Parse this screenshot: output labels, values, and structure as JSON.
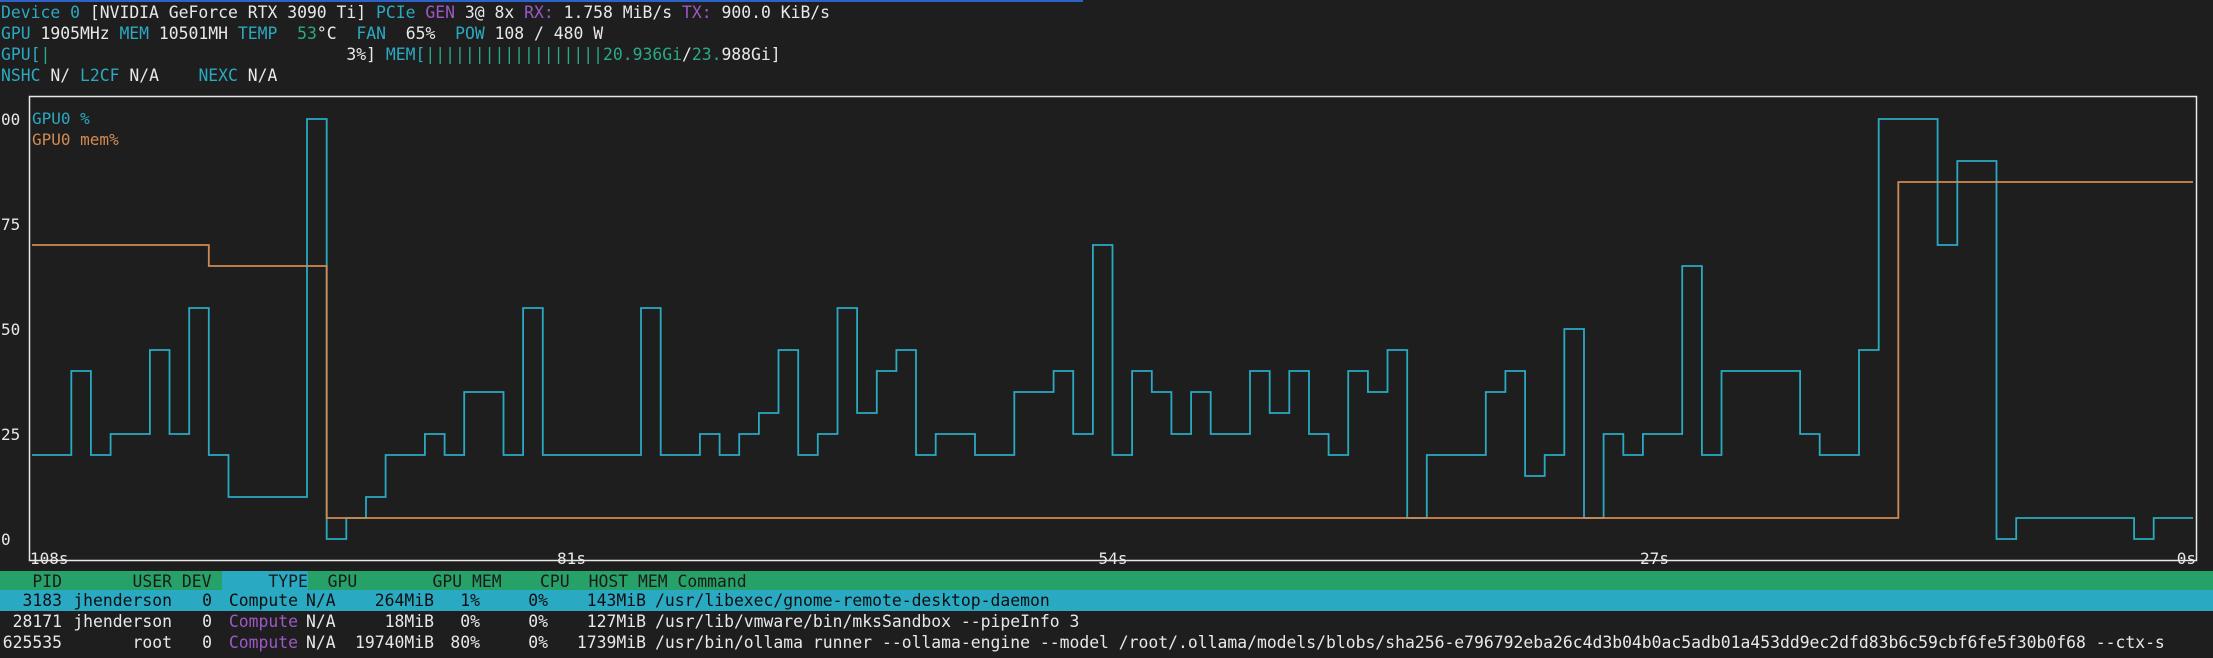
{
  "device": {
    "label": "Device",
    "index": "0",
    "name": "[NVIDIA GeForce RTX 3090 Ti]",
    "pcie_label": "PCIe",
    "gen_label": "GEN",
    "gen_value": "3@ 8x",
    "rx_label": "RX:",
    "rx_value": "1.758 MiB/s",
    "tx_label": "TX:",
    "tx_value": "900.0 KiB/s"
  },
  "stats": {
    "gpu_label": "GPU",
    "gpu_clock": "1905MHz",
    "mem_label": "MEM",
    "mem_clock": "10501MH",
    "temp_label": "TEMP",
    "temp_value": "53",
    "temp_unit": "°C",
    "fan_label": "FAN",
    "fan_value": "65%",
    "pow_label": "POW",
    "pow_value": "108 / 480 W"
  },
  "bars": {
    "gpu_bar_label": "GPU[",
    "gpu_bar_fill": "|",
    "gpu_bar_value": "3%]",
    "mem_bar_label": "MEM[",
    "mem_bar_fill": "||||||||||||||||||",
    "mem_used": "20.936Gi",
    "mem_sep": "/",
    "mem_total_a": "23.",
    "mem_total_b": "988Gi]"
  },
  "nvlink": {
    "nshc_label": "NSHC",
    "nshc_value": "N/",
    "l2cf_label": "L2CF",
    "l2cf_value": "N/A",
    "nexc_label": "NEXC",
    "nexc_value": "N/A"
  },
  "chart_data": {
    "type": "line",
    "ylim": [
      0,
      100
    ],
    "yticks": [
      "00",
      "75",
      "50",
      "25",
      "0"
    ],
    "xticks": [
      "108s",
      "81s",
      "54s",
      "27s",
      "0s"
    ],
    "series": [
      {
        "name": "GPU0 %",
        "color": "#2aa9c2",
        "values": [
          20,
          20,
          40,
          20,
          25,
          25,
          45,
          25,
          55,
          20,
          10,
          10,
          10,
          10,
          100,
          0,
          5,
          10,
          20,
          20,
          25,
          20,
          35,
          35,
          20,
          55,
          20,
          20,
          20,
          20,
          20,
          55,
          20,
          20,
          25,
          20,
          25,
          30,
          45,
          20,
          25,
          55,
          30,
          40,
          45,
          20,
          25,
          25,
          20,
          20,
          35,
          35,
          40,
          25,
          70,
          20,
          40,
          35,
          25,
          35,
          25,
          25,
          40,
          30,
          40,
          25,
          20,
          40,
          35,
          45,
          5,
          20,
          20,
          20,
          35,
          40,
          15,
          20,
          50,
          5,
          25,
          20,
          25,
          25,
          65,
          20,
          40,
          40,
          40,
          40,
          25,
          20,
          20,
          45,
          100,
          100,
          100,
          70,
          90,
          90,
          0,
          5,
          5,
          5,
          5,
          5,
          5,
          0,
          5,
          5
        ]
      },
      {
        "name": "GPU0 mem%",
        "color": "#d18a52",
        "values": [
          70,
          70,
          70,
          70,
          70,
          70,
          70,
          70,
          70,
          65,
          65,
          65,
          65,
          65,
          65,
          5,
          5,
          5,
          5,
          5,
          5,
          5,
          5,
          5,
          5,
          5,
          5,
          5,
          5,
          5,
          5,
          5,
          5,
          5,
          5,
          5,
          5,
          5,
          5,
          5,
          5,
          5,
          5,
          5,
          5,
          5,
          5,
          5,
          5,
          5,
          5,
          5,
          5,
          5,
          5,
          5,
          5,
          5,
          5,
          5,
          5,
          5,
          5,
          5,
          5,
          5,
          5,
          5,
          5,
          5,
          5,
          5,
          5,
          5,
          5,
          5,
          5,
          5,
          5,
          5,
          5,
          5,
          5,
          5,
          5,
          5,
          5,
          5,
          5,
          5,
          5,
          5,
          5,
          5,
          5,
          85,
          85,
          85,
          85,
          85,
          85,
          85,
          85,
          85,
          85,
          85,
          85,
          85,
          85,
          85
        ]
      }
    ]
  },
  "process_table": {
    "columns": [
      "PID",
      "USER",
      "DEV",
      "TYPE",
      "GPU",
      "GPU MEM",
      "CPU",
      "HOST MEM",
      "Command"
    ],
    "rows": [
      {
        "pid": "3183",
        "user": "jhenderson",
        "dev": "0",
        "type": "Compute",
        "gpu": "N/A",
        "gpu_mem": "264MiB",
        "gpu_mem_pct": "1%",
        "cpu": "0%",
        "host_mem": "143MiB",
        "command": "/usr/libexec/gnome-remote-desktop-daemon"
      },
      {
        "pid": "28171",
        "user": "jhenderson",
        "dev": "0",
        "type": "Compute",
        "gpu": "N/A",
        "gpu_mem": "18MiB",
        "gpu_mem_pct": "0%",
        "cpu": "0%",
        "host_mem": "127MiB",
        "command": "/usr/lib/vmware/bin/mksSandbox --pipeInfo 3"
      },
      {
        "pid": "625535",
        "user": "root",
        "dev": "0",
        "type": "Compute",
        "gpu": "N/A",
        "gpu_mem": "19740MiB",
        "gpu_mem_pct": "80%",
        "cpu": "0%",
        "host_mem": "1739MiB",
        "command": "/usr/bin/ollama runner --ollama-engine --model /root/.ollama/models/blobs/sha256-e796792eba26c4d3b04b0ac5adb01a453dd9ec2dfd83b6c59cbf6fe5f30b0f68 --ctx-s"
      }
    ]
  }
}
